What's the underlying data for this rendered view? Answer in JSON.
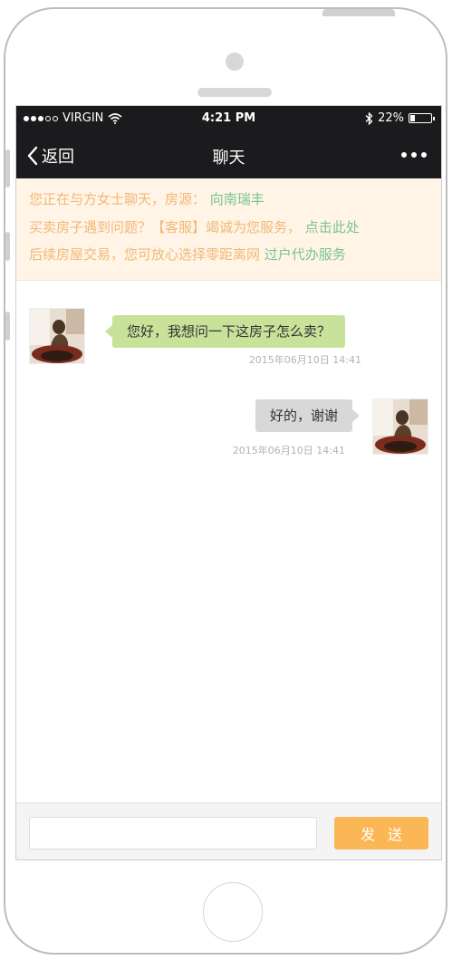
{
  "status_bar": {
    "carrier": "VIRGIN",
    "time": "4:21 PM",
    "battery": "22%",
    "battery_level": 0.22,
    "icons": [
      "signal-dots-icon",
      "wifi-icon",
      "bluetooth-icon",
      "battery-icon"
    ]
  },
  "nav": {
    "back_label": "返回",
    "title": "聊天",
    "more_icon": "more-dots-icon"
  },
  "notice": {
    "line1_text": "您正在与方女士聊天，房源：",
    "line1_link": "向南瑞丰",
    "line2_text": "买卖房子遇到问题？【客服】竭诚为您服务，",
    "line2_link": "点击此处",
    "line3_text": "后续房屋交易，您可放心选择零距离网",
    "line3_link": "过户代办服务",
    "text_color": "#f1b879",
    "link_color": "#79c48f",
    "background": "#fff4e6"
  },
  "messages": [
    {
      "side": "left",
      "text": "您好，我想问一下这房子怎么卖？",
      "time": "2015年06月10日 14:41",
      "bubble_color": "#c8e29a"
    },
    {
      "side": "right",
      "text": "好的，谢谢",
      "time": "2015年06月10日 14:41",
      "bubble_color": "#d8d8d8"
    }
  ],
  "composer": {
    "input_value": "",
    "placeholder": "",
    "send_label": "发送",
    "send_color": "#fbb756"
  }
}
